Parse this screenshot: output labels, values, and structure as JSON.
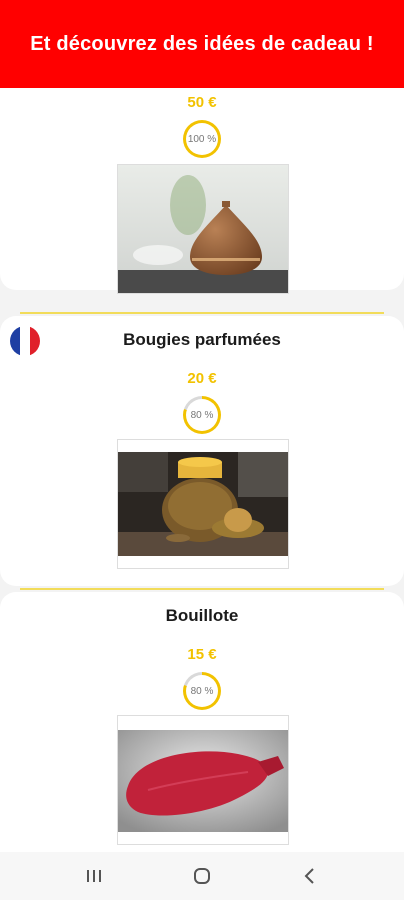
{
  "header": {
    "title": "Et découvrez des idées de cadeau !"
  },
  "items": [
    {
      "title": "",
      "price": "50 €",
      "percent_label": "100 %",
      "percent": 100,
      "image": "essential-oil-diffuser"
    },
    {
      "title": "Bougies parfumées",
      "price": "20 €",
      "percent_label": "80 %",
      "percent": 80,
      "image": "scented-candles",
      "flag": "france-flag-icon"
    },
    {
      "title": "Bouillote",
      "price": "15 €",
      "percent_label": "80 %",
      "percent": 80,
      "image": "hot-water-bottle"
    }
  ],
  "colors": {
    "accent_red": "#ff0000",
    "price_yellow": "#f2c200",
    "divider_yellow": "#f2dc5a"
  },
  "navbar": {
    "recent_icon": "recent-apps-icon",
    "home_icon": "home-icon",
    "back_icon": "back-icon"
  }
}
